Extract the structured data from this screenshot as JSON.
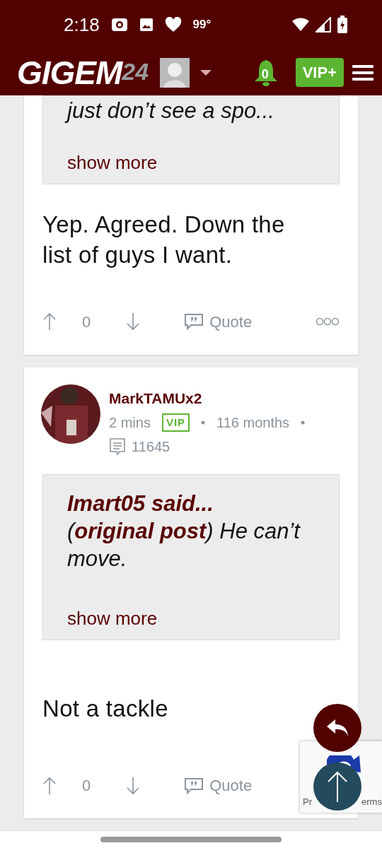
{
  "status_bar": {
    "time": "2:18",
    "temperature": "99°"
  },
  "header": {
    "logo": "GIGEM",
    "logo_suffix": "24",
    "notifications": "0",
    "vip_button": "VIP+"
  },
  "posts": [
    {
      "quote": {
        "text": "just don’t see a spo...",
        "show_more": "show more"
      },
      "body": "Yep. Agreed. Down the list of guys I want.",
      "actions": {
        "score": "0",
        "quote": "Quote"
      }
    },
    {
      "author": {
        "name": "MarkTAMUx2",
        "time": "2 mins",
        "badge": "VIP",
        "tenure": "116 months",
        "post_count": "11645"
      },
      "quote": {
        "author": "Imart05 said...",
        "text": "(**original post**) He can’t move.",
        "show_more": "show more"
      },
      "body": "Not a tackle",
      "actions": {
        "score": "0",
        "quote": "Quote"
      }
    }
  ],
  "recaptcha": {
    "privacy": "Pr",
    "terms": "erms"
  }
}
